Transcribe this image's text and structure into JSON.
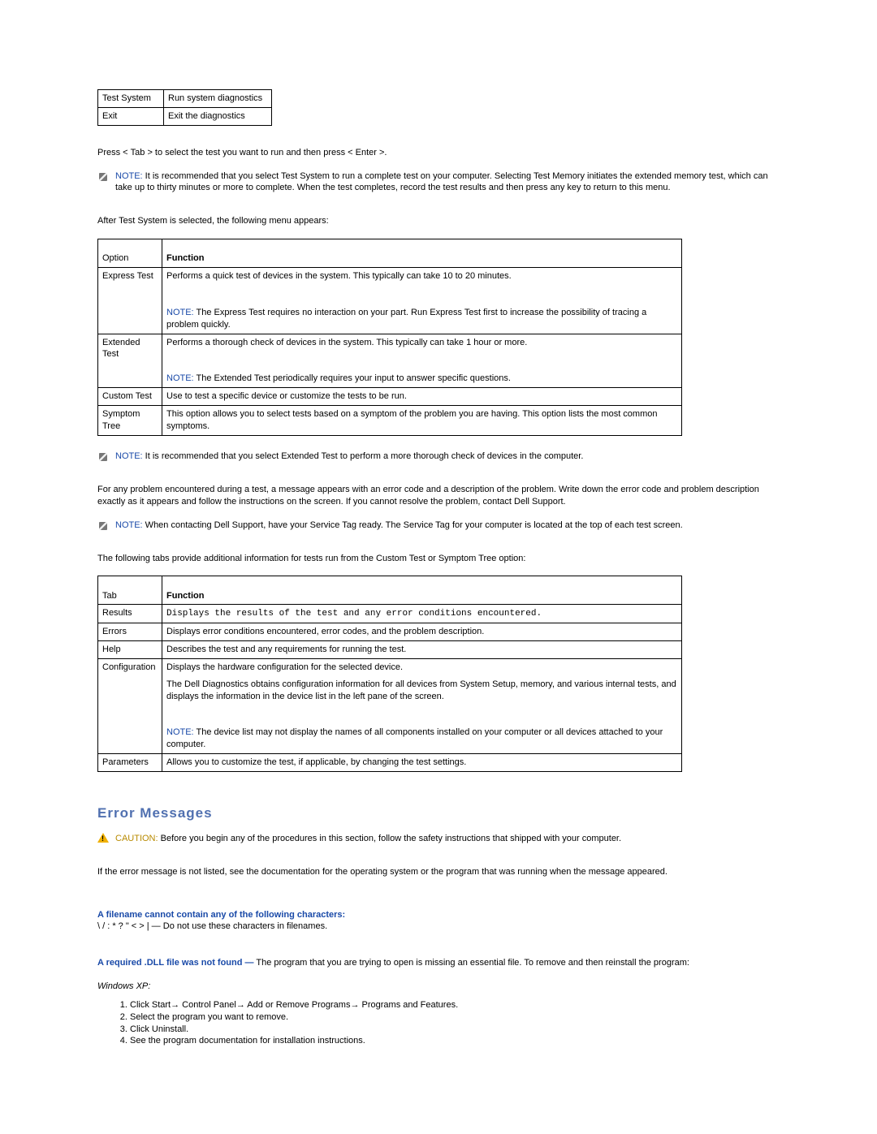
{
  "table1": {
    "rows": [
      {
        "c0": "Test System",
        "c1": "Run system diagnostics"
      },
      {
        "c0": "Exit",
        "c1": "Exit the diagnostics"
      }
    ]
  },
  "press_tab": "Press < Tab > to select the test you want to run and then press < Enter >.",
  "note1": {
    "label": "NOTE:",
    "text": " It is recommended that you select Test System to run a complete test on your computer. Selecting Test Memory initiates the extended memory test, which can take up to thirty minutes or more to complete. When the test completes, record the test results and then press any key to return to this menu."
  },
  "after_test_system": "After Test System is selected, the following menu appears:",
  "table2": {
    "h0": "Option",
    "h1": "Function",
    "rows": [
      {
        "c0": "Express Test",
        "c1_main": "Performs a quick test of devices in the system. This typically can take 10 to 20 minutes.",
        "note_label": "NOTE:",
        "note_text": " The Express Test requires no interaction on your part. Run Express Test first to increase the possibility of tracing a problem quickly."
      },
      {
        "c0": "Extended Test",
        "c1_main": "Performs a thorough check of devices in the system. This typically can take 1 hour or more.",
        "note_label": "NOTE:",
        "note_text": " The Extended Test periodically requires your input to answer specific questions."
      },
      {
        "c0": "Custom Test",
        "c1_main": "Use to test a specific device or customize the tests to be run."
      },
      {
        "c0": "Symptom Tree",
        "c1_main": "This option allows you to select tests based on a symptom of the problem you are having. This option lists the most common symptoms."
      }
    ]
  },
  "note2": {
    "label": "NOTE:",
    "text": " It is recommended that you select Extended Test to perform a more thorough check of devices in the computer."
  },
  "problem_para": "For any problem encountered during a test, a message appears with an error code and a description of the problem. Write down the error code and problem description exactly as it appears and follow the instructions on the screen. If you cannot resolve the problem, contact Dell Support.",
  "note3": {
    "label": "NOTE:",
    "text": " When contacting Dell Support, have your Service Tag ready. The Service Tag for your computer is located at the top of each test screen."
  },
  "tabs_intro": "The following tabs provide additional information for tests run from the Custom Test or Symptom Tree option:",
  "table3": {
    "h0": "Tab",
    "h1": "Function",
    "rows": [
      {
        "c0": "Results",
        "c1_main": "Displays the results of the test and any error conditions encountered."
      },
      {
        "c0": "Errors",
        "c1_main": "Displays error conditions encountered, error codes, and the problem description."
      },
      {
        "c0": "Help",
        "c1_main": "Describes the test and any requirements for running the test."
      },
      {
        "c0": "Configuration",
        "c1_main": "Displays the hardware configuration for the selected device.",
        "c1_extra": "The Dell Diagnostics obtains configuration information for all devices from System Setup, memory, and various internal tests, and displays the information in the device list in the left pane of the screen.",
        "note_label": "NOTE:",
        "note_text": " The device list may not display the names of all components installed on your computer or all devices attached to your computer."
      },
      {
        "c0": "Parameters",
        "c1_main": "Allows you to customize the test, if applicable, by changing the test settings."
      }
    ]
  },
  "section_title": "Error Messages",
  "caution": {
    "label": "CAUTION:",
    "text": " Before you begin any of the procedures in this section, follow the safety instructions that shipped with your computer."
  },
  "err_not_listed": "If the error message is not listed, see the documentation for the operating system or the program that was running when the message appeared.",
  "filename_line": {
    "lead": "A filename cannot contain any of the following characters:",
    "chars": "\\ / : * ? \" < > | —",
    "tail": " Do not use these characters in filenames."
  },
  "dll_line": {
    "lead": "A required .DLL file was not found —",
    "tail": " The program that you are trying to open is missing an essential file. To remove and then reinstall the program:"
  },
  "winxp": "Windows XP:",
  "steps": {
    "s1a": "Click Start",
    "s1b": " Control Panel",
    "s1c": " Add or Remove Programs",
    "s1d": " Programs and Features.",
    "s2": "Select the program you want to remove.",
    "s3": "Click Uninstall.",
    "s4": "See the program documentation for installation instructions."
  },
  "arrow": "→"
}
